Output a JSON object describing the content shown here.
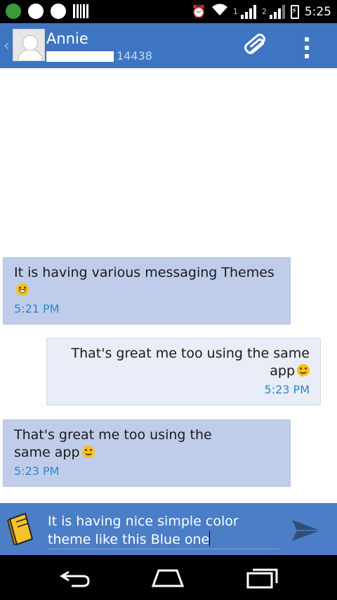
{
  "status_bar": {
    "sim1_label": "1",
    "sim2_label": "2",
    "time": "5:25"
  },
  "header": {
    "back_glyph": "‹",
    "contact_name": "Annie",
    "contact_phone_visible": "14438",
    "avatar_icon": "person-avatar-icon",
    "attach_icon": "paperclip-icon",
    "menu_icon": "overflow-menu-icon",
    "accent_color": "#3e75c3"
  },
  "messages": [
    {
      "direction": "incoming",
      "text": "It is having various messaging Themes",
      "emoji": "grin",
      "time": "5:21 PM"
    },
    {
      "direction": "outgoing",
      "text": "That's great me too using the same app",
      "emoji": "smile",
      "time": "5:23 PM"
    },
    {
      "direction": "incoming",
      "text": "That's great me too using the same app",
      "emoji": "smile",
      "time": "5:23 PM"
    }
  ],
  "compose": {
    "text": "It is having nice simple color theme like this Blue one",
    "attach_icon": "notebook-icon",
    "send_icon": "send-icon"
  },
  "nav_bar": {
    "back_icon": "back-icon",
    "home_icon": "home-icon",
    "recents_icon": "recents-icon"
  }
}
